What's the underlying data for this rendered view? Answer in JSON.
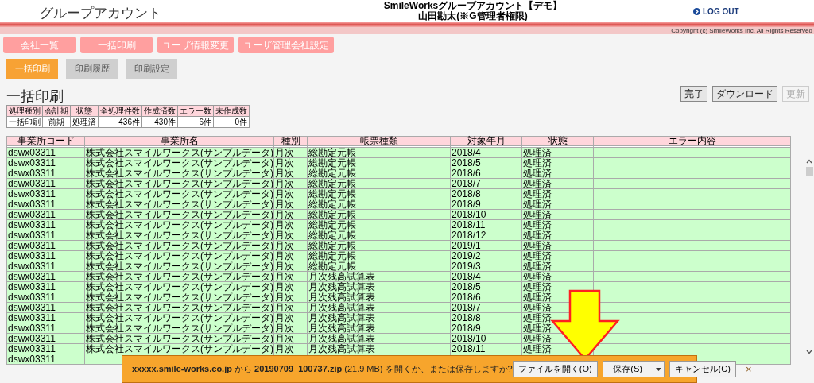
{
  "header": {
    "title": "グループアカウント",
    "app_name": "SmileWorksグループアカウント【デモ】",
    "user": "山田勘太(※G管理者権限)",
    "logout": "LOG OUT"
  },
  "copyright": "Copyright (c) SmileWorks Inc. All Rights Reserved",
  "nav_buttons": [
    "会社一覧",
    "一括印刷",
    "ユーザ情報変更",
    "ユーザ管理会社設定"
  ],
  "tabs": [
    {
      "label": "一括印刷",
      "selected": true
    },
    {
      "label": "印刷履歴",
      "selected": false
    },
    {
      "label": "印刷設定",
      "selected": false
    }
  ],
  "page_title": "一括印刷",
  "action_buttons": [
    {
      "label": "完了",
      "disabled": false
    },
    {
      "label": "ダウンロード",
      "disabled": false
    },
    {
      "label": "更新",
      "disabled": true
    }
  ],
  "summary": {
    "columns": [
      "処理種別",
      "会計期",
      "状態",
      "全処理件数",
      "作成済数",
      "エラー数",
      "未作成数"
    ],
    "row": [
      "一括印刷",
      "前期",
      "処理済",
      "436件",
      "430件",
      "6件",
      "0件"
    ]
  },
  "table": {
    "columns": [
      "事業所コード",
      "事業所名",
      "種別",
      "帳票種類",
      "対象年月",
      "状態",
      "エラー内容"
    ],
    "rows": [
      [
        "dswx03311",
        "株式会社スマイルワークス(サンプルデータ)",
        "月次",
        "総勘定元帳",
        "2018/4",
        "処理済"
      ],
      [
        "dswx03311",
        "株式会社スマイルワークス(サンプルデータ)",
        "月次",
        "総勘定元帳",
        "2018/5",
        "処理済"
      ],
      [
        "dswx03311",
        "株式会社スマイルワークス(サンプルデータ)",
        "月次",
        "総勘定元帳",
        "2018/6",
        "処理済"
      ],
      [
        "dswx03311",
        "株式会社スマイルワークス(サンプルデータ)",
        "月次",
        "総勘定元帳",
        "2018/7",
        "処理済"
      ],
      [
        "dswx03311",
        "株式会社スマイルワークス(サンプルデータ)",
        "月次",
        "総勘定元帳",
        "2018/8",
        "処理済"
      ],
      [
        "dswx03311",
        "株式会社スマイルワークス(サンプルデータ)",
        "月次",
        "総勘定元帳",
        "2018/9",
        "処理済"
      ],
      [
        "dswx03311",
        "株式会社スマイルワークス(サンプルデータ)",
        "月次",
        "総勘定元帳",
        "2018/10",
        "処理済"
      ],
      [
        "dswx03311",
        "株式会社スマイルワークス(サンプルデータ)",
        "月次",
        "総勘定元帳",
        "2018/11",
        "処理済"
      ],
      [
        "dswx03311",
        "株式会社スマイルワークス(サンプルデータ)",
        "月次",
        "総勘定元帳",
        "2018/12",
        "処理済"
      ],
      [
        "dswx03311",
        "株式会社スマイルワークス(サンプルデータ)",
        "月次",
        "総勘定元帳",
        "2019/1",
        "処理済"
      ],
      [
        "dswx03311",
        "株式会社スマイルワークス(サンプルデータ)",
        "月次",
        "総勘定元帳",
        "2019/2",
        "処理済"
      ],
      [
        "dswx03311",
        "株式会社スマイルワークス(サンプルデータ)",
        "月次",
        "総勘定元帳",
        "2019/3",
        "処理済"
      ],
      [
        "dswx03311",
        "株式会社スマイルワークス(サンプルデータ)",
        "月次",
        "月次残高試算表",
        "2018/4",
        "処理済"
      ],
      [
        "dswx03311",
        "株式会社スマイルワークス(サンプルデータ)",
        "月次",
        "月次残高試算表",
        "2018/5",
        "処理済"
      ],
      [
        "dswx03311",
        "株式会社スマイルワークス(サンプルデータ)",
        "月次",
        "月次残高試算表",
        "2018/6",
        "処理済"
      ],
      [
        "dswx03311",
        "株式会社スマイルワークス(サンプルデータ)",
        "月次",
        "月次残高試算表",
        "2018/7",
        "処理済"
      ],
      [
        "dswx03311",
        "株式会社スマイルワークス(サンプルデータ)",
        "月次",
        "月次残高試算表",
        "2018/8",
        "処理済"
      ],
      [
        "dswx03311",
        "株式会社スマイルワークス(サンプルデータ)",
        "月次",
        "月次残高試算表",
        "2018/9",
        "処理済"
      ],
      [
        "dswx03311",
        "株式会社スマイルワークス(サンプルデータ)",
        "月次",
        "月次残高試算表",
        "2018/10",
        "処理済"
      ],
      [
        "dswx03311",
        "株式会社スマイルワークス(サンプルデータ)",
        "月次",
        "月次残高試算表",
        "2018/11",
        "処理済"
      ],
      [
        "dswx03311"
      ]
    ]
  },
  "download_bar": {
    "message": "**xxxxx.smile-works.co.jp** から **20190709_100737.zip** (21.9 MB) を開くか、または保存しますか?",
    "buttons": [
      "ファイルを開く(O)",
      "保存(S)",
      "キャンセル(C)"
    ],
    "close": "×"
  }
}
